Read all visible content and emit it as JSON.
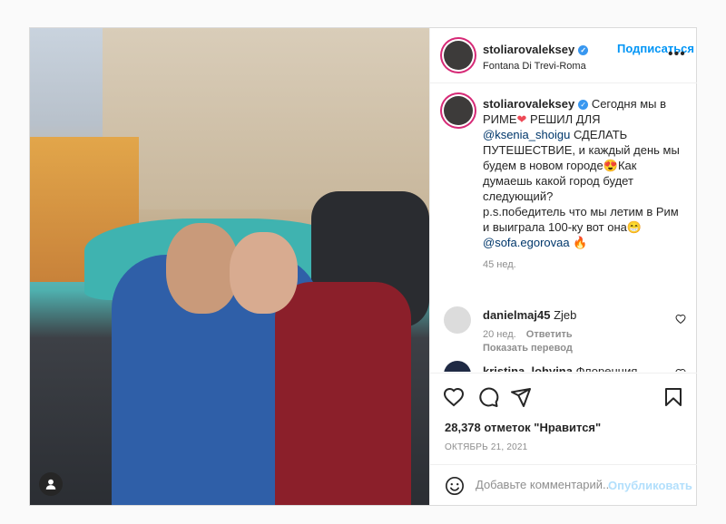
{
  "post": {
    "author": "stoliarovaleksey",
    "follow_label": "Подписаться",
    "location": "Fontana Di Trevi-Roma",
    "more_label": "•••"
  },
  "caption": {
    "author": "stoliarovaleksey",
    "text_1": "Сегодня мы в РИМЕ",
    "text_2": "РЕШИЛ ДЛЯ",
    "mention_1": "@ksenia_shoigu",
    "text_3": "СДЕЛАТЬ ПУТЕШЕСТВИЕ, и каждый день мы будем в новом городе",
    "text_4": "Как думаешь какой город будет следующий?",
    "text_5": "p.s.победитель что мы летим в Рим и выиграла 100-ку вот она",
    "mention_2": "@sofa.egorovaa",
    "time": "45 нед."
  },
  "comments": [
    {
      "author": "danielmaj45",
      "text": "Zjeb",
      "time": "20 нед.",
      "reply_label": "Ответить",
      "translate_label": "Показать перевод"
    },
    {
      "author": "kristina_lohvina",
      "text": "Флоренция"
    }
  ],
  "likes": "28,378 отметок \"Нравится\"",
  "date": "ОКТЯБРЬ 21, 2021",
  "add_comment": {
    "placeholder": "Добавьте комментарий...",
    "publish_label": "Опубликовать"
  },
  "colors": {
    "accent": "#0095f6",
    "verified": "#3897f0",
    "heart": "#ed4956"
  }
}
